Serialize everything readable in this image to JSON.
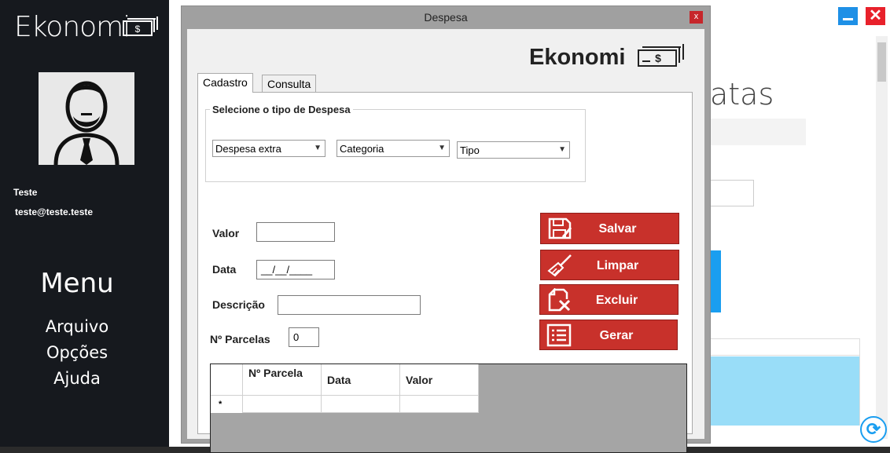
{
  "main_window": {
    "sidebar": {
      "logo": "Ekonomi",
      "user_name": "Teste",
      "user_email": "teste@teste.teste",
      "menu_title": "Menu",
      "menu_items": [
        "Arquivo",
        "Opções",
        "Ajuda"
      ]
    },
    "background_heading": "atas",
    "close_glyph": "✕",
    "refresh_glyph": "⟳"
  },
  "dialog": {
    "title": "Despesa",
    "close_glyph": "x",
    "logo": "Ekonomi",
    "tabs": [
      "Cadastro",
      "Consulta"
    ],
    "active_tab": "Cadastro",
    "group_title": "Selecione o tipo de Despesa",
    "dropdowns": {
      "tipo_despesa": "Despesa extra",
      "categoria": "Categoria",
      "tipo": "Tipo"
    },
    "fields": {
      "valor_label": "Valor",
      "valor_value": "",
      "data_label": "Data",
      "data_value": "__/__/____",
      "descricao_label": "Descrição",
      "descricao_value": "",
      "parcelas_label": "Nº Parcelas",
      "parcelas_value": "0"
    },
    "buttons": {
      "salvar": "Salvar",
      "limpar": "Limpar",
      "excluir": "Excluir",
      "gerar": "Gerar"
    },
    "grid": {
      "columns": [
        "Nº Parcela",
        "Data",
        "Valor"
      ],
      "new_row_marker": "*"
    }
  },
  "colors": {
    "sidebar_bg": "#16191e",
    "action_red": "#c8312b",
    "accent_blue": "#1a9ef0",
    "close_red": "#e8212b"
  },
  "icons": [
    "money-icon",
    "user-avatar-icon",
    "save-icon",
    "broom-icon",
    "delete-file-icon",
    "list-icon",
    "refresh-icon"
  ]
}
